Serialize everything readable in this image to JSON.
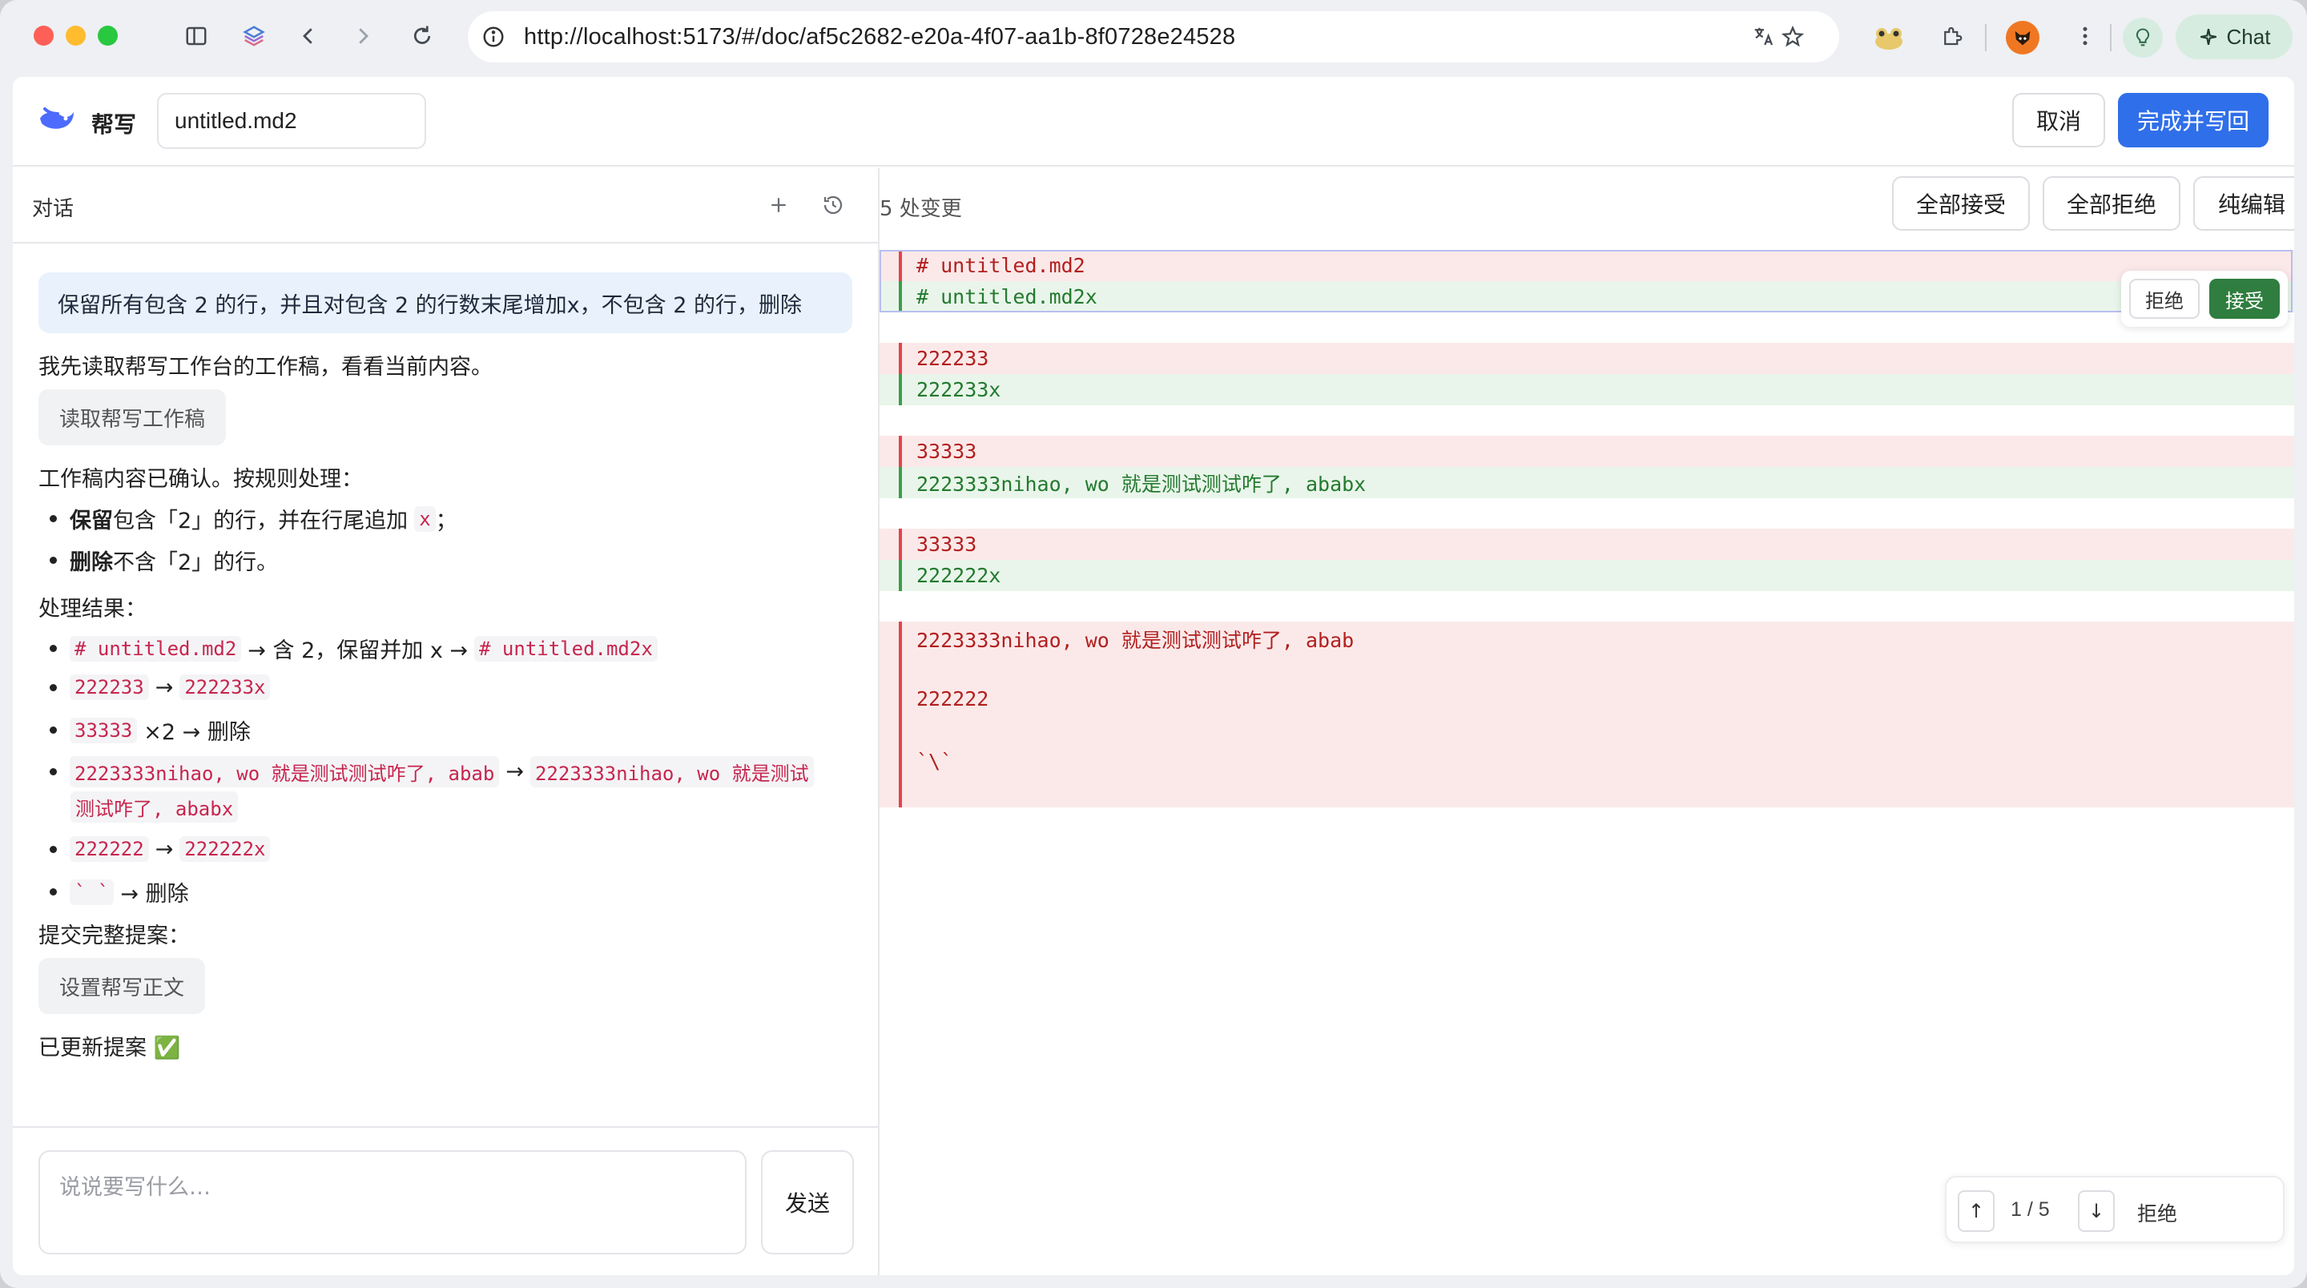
{
  "browser": {
    "url": "http://localhost:5173/#/doc/af5c2682-e20a-4f07-aa1b-8f0728e24528",
    "chat_label": "Chat"
  },
  "header": {
    "app_title": "帮写",
    "filename": "untitled.md2",
    "cancel_label": "取消",
    "done_label": "完成并写回",
    "accent_color": "#2f6fe9"
  },
  "chat": {
    "title": "对话",
    "user_message": "保留所有包含 2 的行，并且对包含 2 的行数末尾增加x，不包含 2 的行，删除",
    "reply_intro": "我先读取帮写工作台的工作稿，看看当前内容。",
    "tool_read": "读取帮写工作稿",
    "confirm_text": "工作稿内容已确认。按规则处理：",
    "rules": [
      {
        "strong": "保留",
        "text": "包含「2」的行，并在行尾追加",
        "code": "x",
        "tail": "；"
      },
      {
        "strong": "删除",
        "text": "不含「2」的行。"
      }
    ],
    "result_title": "处理结果：",
    "results": {
      "r1_from": "# untitled.md2",
      "r1_mid": "→ 含 2，保留并加 x →",
      "r1_to": "# untitled.md2x",
      "r2_from": "222233",
      "r2_to": "222233x",
      "r3_from": "33333",
      "r3_mid": "×2 → 删除",
      "r4_from": "2223333nihao, wo 就是测试测试咋了, abab",
      "r4_to_a": "2223333nihao, wo 就是测试",
      "r4_to_b": "测试咋了, ababx",
      "r5_from": "222222",
      "r5_to": "222222x",
      "r6_from": "` `",
      "r6_mid": "→ 删除",
      "arrow": "→"
    },
    "submit_text": "提交完整提案：",
    "tool_set": "设置帮写正文",
    "updated_text": "已更新提案 ✅",
    "input_placeholder": "说说要写什么…",
    "send_label": "发送"
  },
  "diff": {
    "change_count": "5 处变更",
    "accept_all": "全部接受",
    "reject_all": "全部拒绝",
    "plain_edit": "纯编辑",
    "inline_reject": "拒绝",
    "inline_accept": "接受",
    "lines": {
      "b1_del": "# untitled.md2",
      "b1_add": "# untitled.md2x",
      "b2_del": "222233",
      "b2_add": "222233x",
      "b3_del": "33333",
      "b3_add": "2223333nihao, wo 就是测试测试咋了, ababx",
      "b4_del": "33333",
      "b4_add": "222222x",
      "b5_del_1": "2223333nihao, wo 就是测试测试咋了, abab",
      "b5_del_2": "222222",
      "b5_del_3": "`\\`"
    },
    "nav": {
      "up": "↑",
      "down": "↓",
      "count": "1 / 5",
      "reject": "拒绝"
    },
    "colors": {
      "deleted_bg": "#fbe9e9",
      "added_bg": "#e9f5ea",
      "accept_green": "#2f7d3f"
    }
  }
}
